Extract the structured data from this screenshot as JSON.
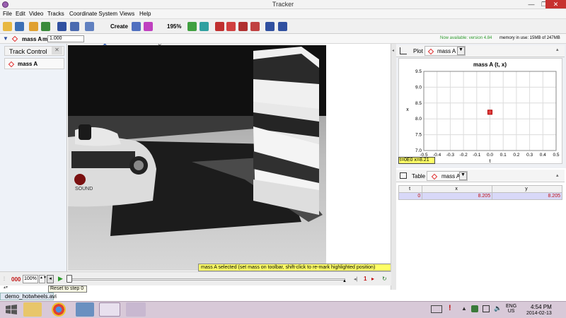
{
  "window": {
    "title": "Tracker",
    "min_glyph": "—",
    "max_glyph": "❐",
    "close_glyph": "✕"
  },
  "menu": [
    "File",
    "Edit",
    "Video",
    "Tracks",
    "Coordinate System",
    "Views",
    "Help"
  ],
  "toolbar": {
    "create_label": "Create",
    "zoom_label": "195%"
  },
  "track_row": {
    "track_name": "mass A",
    "mass_label": "m",
    "mass_value": "1.000",
    "update_notice": "Now available: version 4.84",
    "memory": "memory in use: 15MB of 247MB"
  },
  "track_control": {
    "title": "Track Control",
    "close_glyph": "✕",
    "track_button": "mass A"
  },
  "status_tip": "mass A selected (set mass on toolbar, shift-click to re-mark highlighted position)",
  "playback": {
    "frame": "000",
    "rate": "100%",
    "tooltip": "Reset to step 0",
    "step_size": "1",
    "file_tab": "demo_hotwheels.avi"
  },
  "plot": {
    "tab_label": "Plot",
    "track_label": "mass A",
    "readout": "t=0E0  x=8.21"
  },
  "chart_data": {
    "type": "scatter",
    "title": "mass A (t, x)",
    "xlabel": "t",
    "ylabel": "x",
    "xlim": [
      -0.5,
      0.5
    ],
    "ylim": [
      7.0,
      9.5
    ],
    "xticks": [
      "-0.5",
      "-0.4",
      "-0.3",
      "-0.2",
      "-0.1",
      "0.0",
      "0.1",
      "0.2",
      "0.3",
      "0.4",
      "0.5"
    ],
    "yticks": [
      "7.0",
      "7.5",
      "8.0",
      "8.5",
      "9.0",
      "9.5"
    ],
    "grid": true,
    "points": [
      {
        "x": 0.0,
        "y": 8.21
      }
    ]
  },
  "table": {
    "tab_label": "Table",
    "track_label": "mass A",
    "columns": [
      "t",
      "x",
      "y"
    ],
    "rows": [
      [
        "0",
        "8.205",
        "8.205"
      ]
    ]
  },
  "taskbar": {
    "lang": "ENG",
    "region": "US",
    "time": "4:54 PM",
    "date": "2014-02-13"
  },
  "colors": {
    "accent": "#e03030",
    "tip": "#ffff66",
    "taskbar": "#d8c9d8"
  }
}
